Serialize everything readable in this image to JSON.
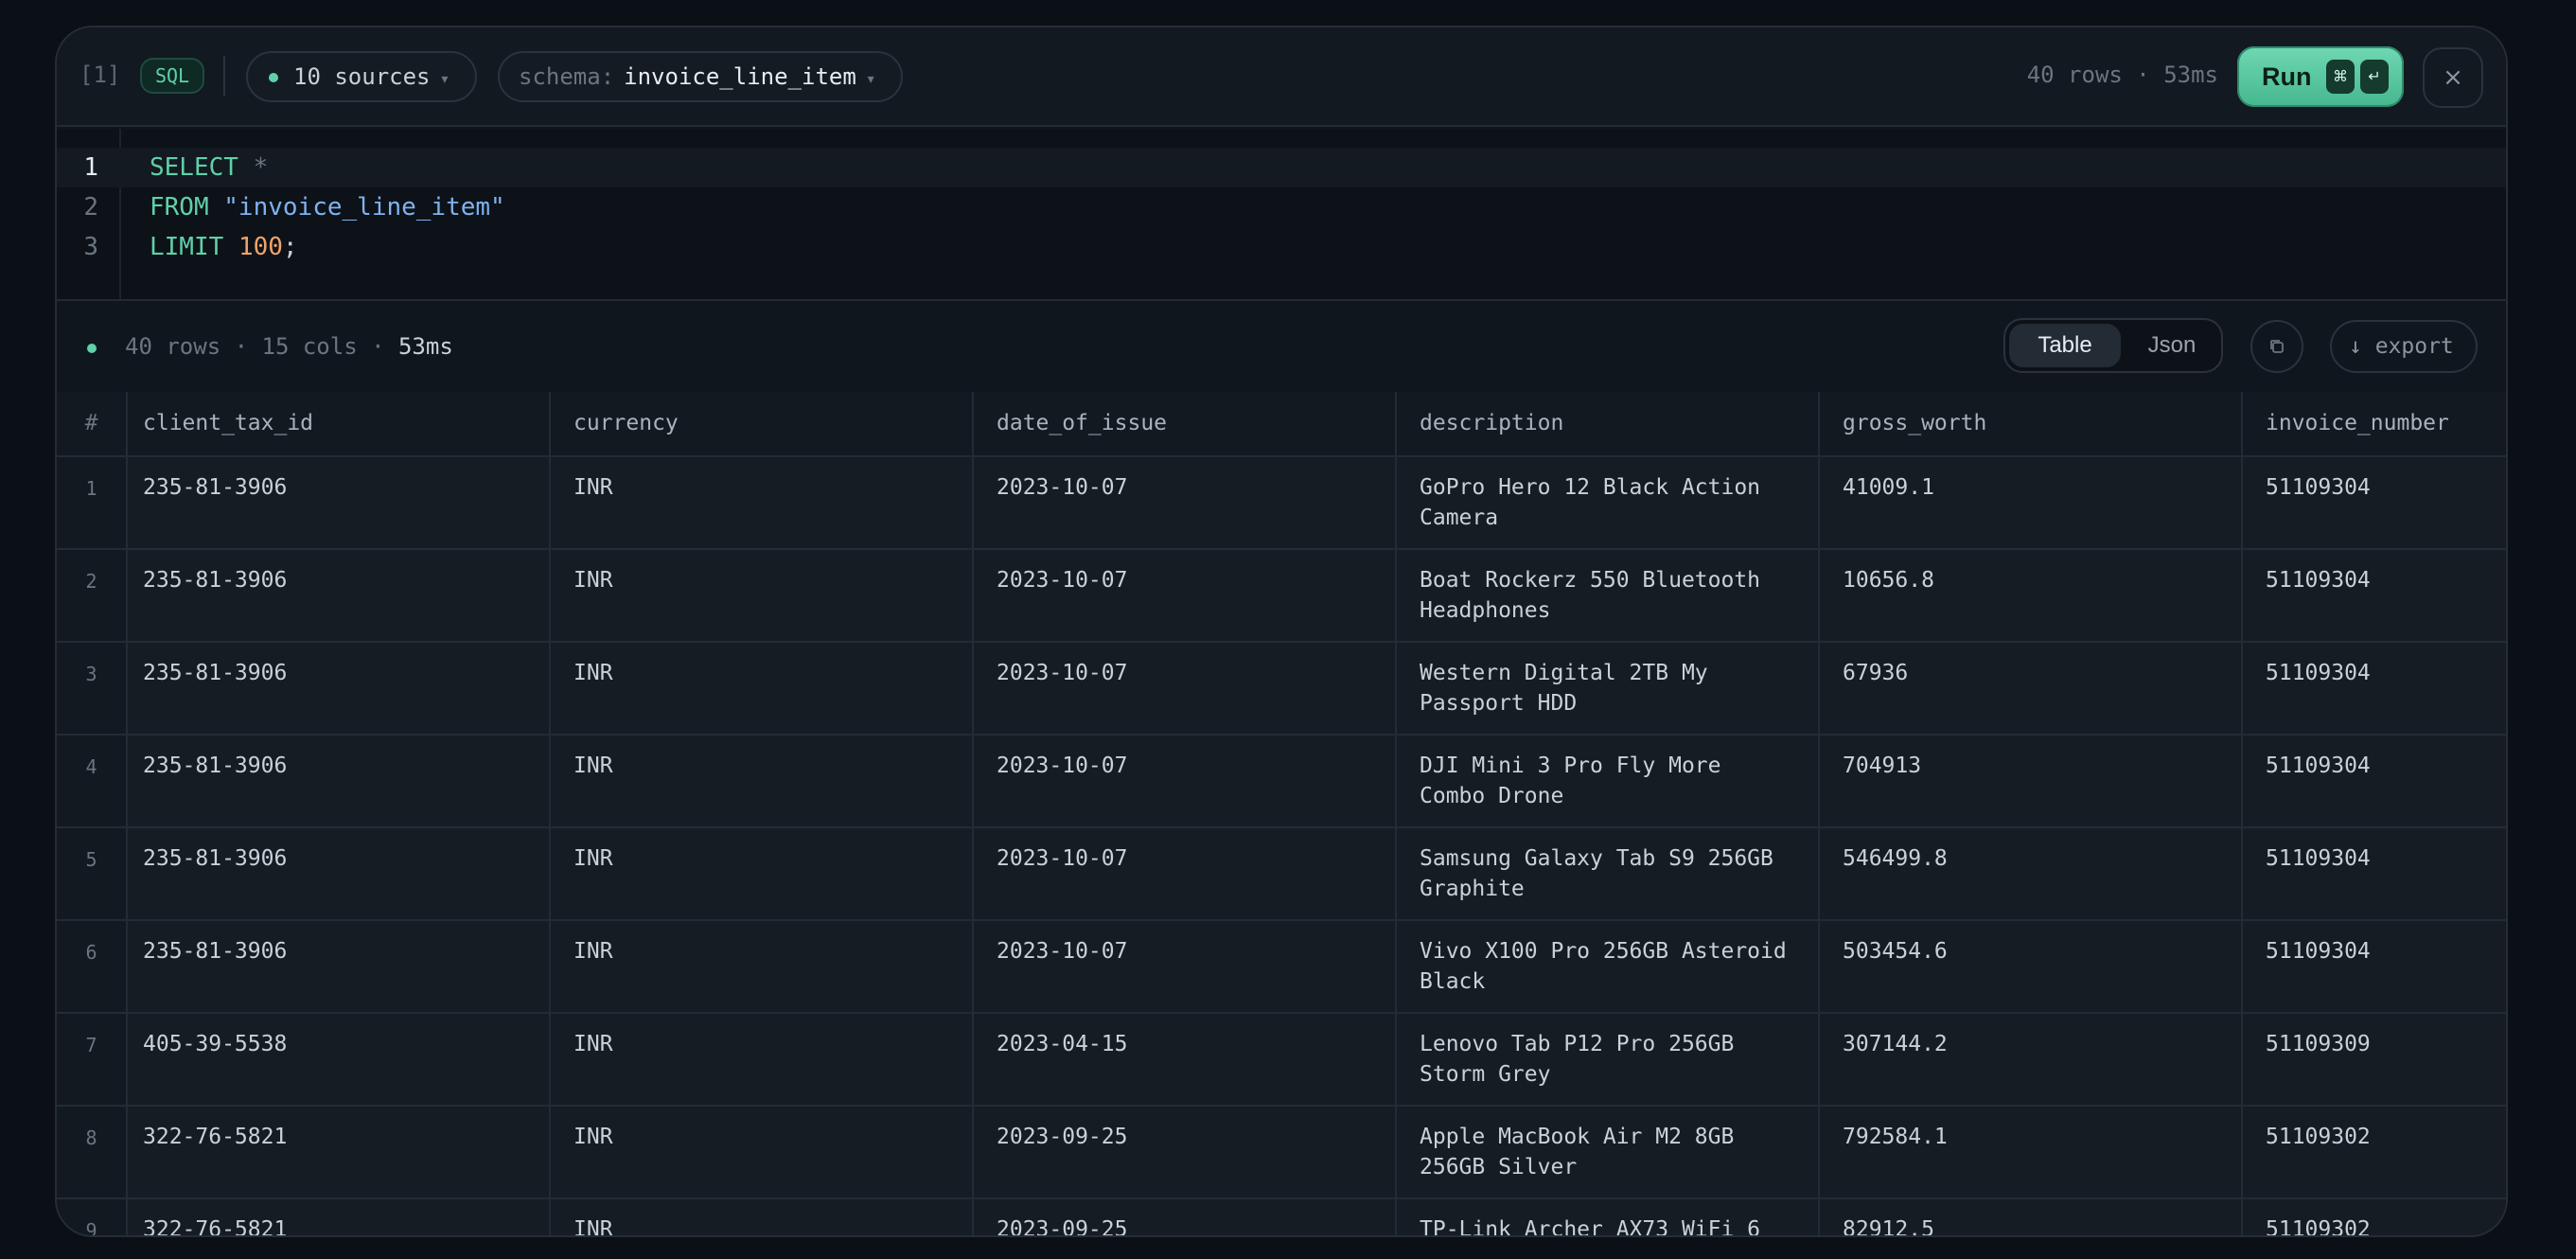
{
  "header": {
    "cell_index": "[1]",
    "language_badge": "SQL",
    "sources_label": "10 sources",
    "schema_label": "schema:",
    "schema_value": "invoice_line_item",
    "caret": "▾",
    "stats": "40 rows · 53ms",
    "run_label": "Run",
    "run_shortcut_cmd": "⌘",
    "run_shortcut_enter": "↵",
    "close_glyph": "×"
  },
  "editor": {
    "lines": [
      {
        "number": "1",
        "tokens": [
          {
            "t": "SELECT",
            "c": "kw"
          },
          {
            "t": " ",
            "c": "plain"
          },
          {
            "t": "*",
            "c": "op"
          }
        ]
      },
      {
        "number": "2",
        "tokens": [
          {
            "t": "FROM",
            "c": "kw"
          },
          {
            "t": " ",
            "c": "plain"
          },
          {
            "t": "\"invoice_line_item\"",
            "c": "str"
          }
        ]
      },
      {
        "number": "3",
        "tokens": [
          {
            "t": "LIMIT",
            "c": "kw"
          },
          {
            "t": " ",
            "c": "plain"
          },
          {
            "t": "100",
            "c": "num"
          },
          {
            "t": ";",
            "c": "plain"
          }
        ]
      }
    ]
  },
  "results": {
    "stats_prefix": "40 rows · 15 cols · ",
    "stats_ms": "53ms",
    "view_table": "Table",
    "view_json": "Json",
    "export_label": "↓ export"
  },
  "table": {
    "columns": [
      "#",
      "client_tax_id",
      "currency",
      "date_of_issue",
      "description",
      "gross_worth",
      "invoice_number"
    ],
    "rows": [
      [
        "1",
        "235-81-3906",
        "INR",
        "2023-10-07",
        "GoPro Hero 12 Black Action Camera",
        "41009.1",
        "51109304"
      ],
      [
        "2",
        "235-81-3906",
        "INR",
        "2023-10-07",
        "Boat Rockerz 550 Bluetooth Headphones",
        "10656.8",
        "51109304"
      ],
      [
        "3",
        "235-81-3906",
        "INR",
        "2023-10-07",
        "Western Digital 2TB My Passport HDD",
        "67936",
        "51109304"
      ],
      [
        "4",
        "235-81-3906",
        "INR",
        "2023-10-07",
        "DJI Mini 3 Pro Fly More Combo Drone",
        "704913",
        "51109304"
      ],
      [
        "5",
        "235-81-3906",
        "INR",
        "2023-10-07",
        "Samsung Galaxy Tab S9 256GB Graphite",
        "546499.8",
        "51109304"
      ],
      [
        "6",
        "235-81-3906",
        "INR",
        "2023-10-07",
        "Vivo X100 Pro 256GB Asteroid Black",
        "503454.6",
        "51109304"
      ],
      [
        "7",
        "405-39-5538",
        "INR",
        "2023-04-15",
        "Lenovo Tab P12 Pro 256GB Storm Grey",
        "307144.2",
        "51109309"
      ],
      [
        "8",
        "322-76-5821",
        "INR",
        "2023-09-25",
        "Apple MacBook Air M2 8GB 256GB Silver",
        "792584.1",
        "51109302"
      ],
      [
        "9",
        "322-76-5821",
        "INR",
        "2023-09-25",
        "TP-Link Archer AX73 WiFi 6",
        "82912.5",
        "51109302"
      ]
    ]
  },
  "colors": {
    "accent": "#5fd1a8",
    "background": "#0b1016",
    "panel": "#10161d"
  }
}
